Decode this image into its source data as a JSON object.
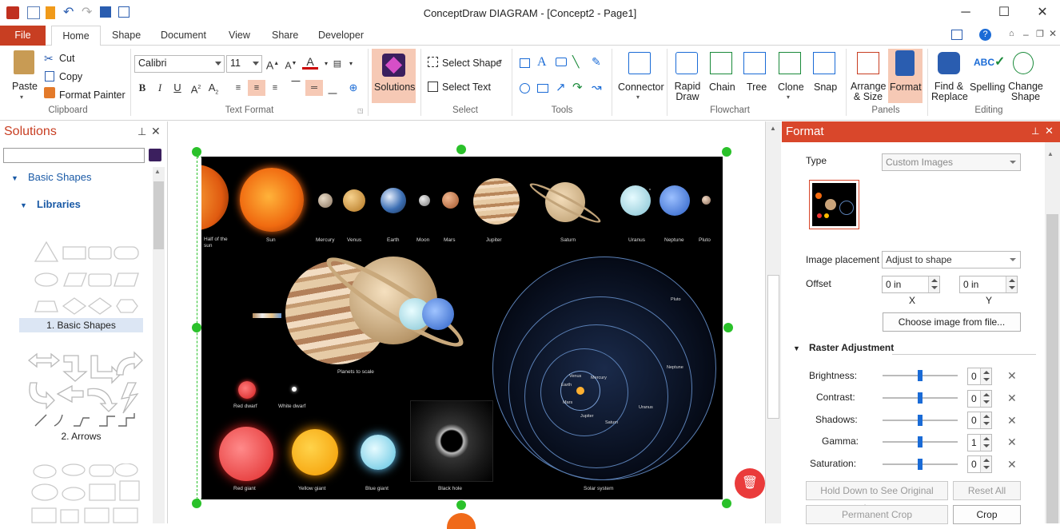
{
  "window": {
    "title": "ConceptDraw DIAGRAM - [Concept2 - Page1]"
  },
  "tabs": [
    "File",
    "Home",
    "Shape",
    "Document",
    "View",
    "Share",
    "Developer"
  ],
  "ribbon": {
    "clipboard": {
      "paste": "Paste",
      "cut": "Cut",
      "copy": "Copy",
      "format_painter": "Format Painter",
      "label": "Clipboard"
    },
    "text_format": {
      "font": "Calibri",
      "size": "11",
      "label": "Text Format"
    },
    "solutions": {
      "label": "Solutions"
    },
    "select": {
      "select_shape": "Select Shape",
      "select_text": "Select Text",
      "label": "Select"
    },
    "tools": {
      "label": "Tools"
    },
    "connector": {
      "label": "Connector"
    },
    "flowchart": {
      "rapid_draw": "Rapid Draw",
      "chain": "Chain",
      "tree": "Tree",
      "clone": "Clone",
      "snap": "Snap",
      "label": "Flowchart"
    },
    "panels": {
      "arrange_size": "Arrange & Size",
      "format": "Format",
      "label": "Panels"
    },
    "editing": {
      "find_replace": "Find & Replace",
      "spelling": "Spelling",
      "change_shape": "Change Shape",
      "label": "Editing"
    }
  },
  "solutions_panel": {
    "title": "Solutions",
    "search_value": "",
    "tree": {
      "basic_shapes": "Basic Shapes",
      "libraries": "Libraries"
    },
    "libraries": [
      "1. Basic Shapes",
      "2. Arrows"
    ]
  },
  "canvas": {
    "planets": [
      "Half of the sun",
      "Sun",
      "Mercury",
      "Venus",
      "Earth",
      "Moon",
      "Mars",
      "Jupiter",
      "Saturn",
      "Uranus",
      "Neptune",
      "Pluto"
    ],
    "captions": {
      "planets_to_scale": "Planets to scale",
      "red_dwarf": "Red dwarf",
      "white_dwarf": "White dwarf",
      "red_giant": "Red giant",
      "yellow_giant": "Yellow giant",
      "blue_giant": "Blue giant",
      "black_hole": "Black hole",
      "solar_system": "Solar system"
    },
    "orbit_labels": [
      "Pluto",
      "Neptune",
      "Uranus",
      "Saturn",
      "Jupiter",
      "Mars",
      "Earth",
      "Venus",
      "Mercury"
    ]
  },
  "format_panel": {
    "title": "Format",
    "type_label": "Type",
    "type_value": "Custom Images",
    "image_placement_label": "Image placement",
    "image_placement_value": "Adjust to shape",
    "offset_label": "Offset",
    "offset_x": "0 in",
    "offset_y": "0 in",
    "x_label": "X",
    "y_label": "Y",
    "choose_image": "Choose image from file...",
    "raster_title": "Raster Adjustment",
    "adjustments": [
      {
        "label": "Brightness:",
        "value": "0"
      },
      {
        "label": "Contrast:",
        "value": "0"
      },
      {
        "label": "Shadows:",
        "value": "0"
      },
      {
        "label": "Gamma:",
        "value": "1"
      },
      {
        "label": "Saturation:",
        "value": "0"
      }
    ],
    "hold_down": "Hold Down to See Original Image",
    "reset_all": "Reset All",
    "permanent_crop": "Permanent Crop",
    "crop": "Crop"
  },
  "colors": {
    "accent": "#c83e22",
    "selected": "#f6c9b5",
    "handle": "#2ac12a"
  }
}
